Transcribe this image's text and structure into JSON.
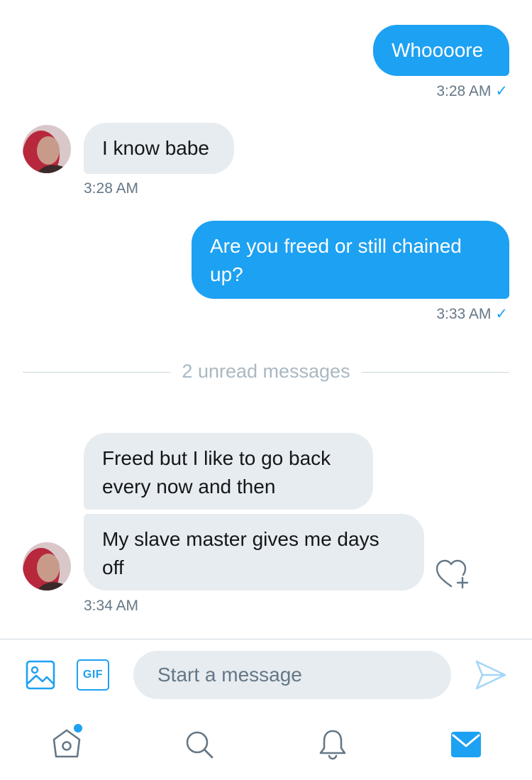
{
  "colors": {
    "accent": "#1da1f2",
    "received_bubble": "#e6ecf0",
    "muted": "#657786",
    "divider": "#ccd6dd"
  },
  "conversation": {
    "messages": [
      {
        "direction": "sent",
        "text": "Whoooore",
        "time": "3:28 AM",
        "status_icon": "check-icon"
      },
      {
        "direction": "received",
        "text": "I know babe",
        "time": "3:28 AM"
      },
      {
        "direction": "sent",
        "text": "Are you freed or still chained up?",
        "time": "3:33 AM",
        "status_icon": "check-icon"
      },
      {
        "direction": "received",
        "text": "Freed but I like to go back every now and then"
      },
      {
        "direction": "received",
        "text": "My slave master gives me days off",
        "time": "3:34 AM"
      }
    ],
    "unread_divider": "2 unread messages",
    "check_mark": "✓"
  },
  "composer": {
    "placeholder": "Start a message",
    "gif_label": "GIF",
    "icons": [
      "image-icon",
      "gif-icon",
      "send-icon"
    ]
  },
  "tab_bar": {
    "items": [
      "home-icon",
      "search-icon",
      "notifications-icon",
      "messages-icon"
    ],
    "active": "messages-icon",
    "home_has_new_indicator": true
  }
}
